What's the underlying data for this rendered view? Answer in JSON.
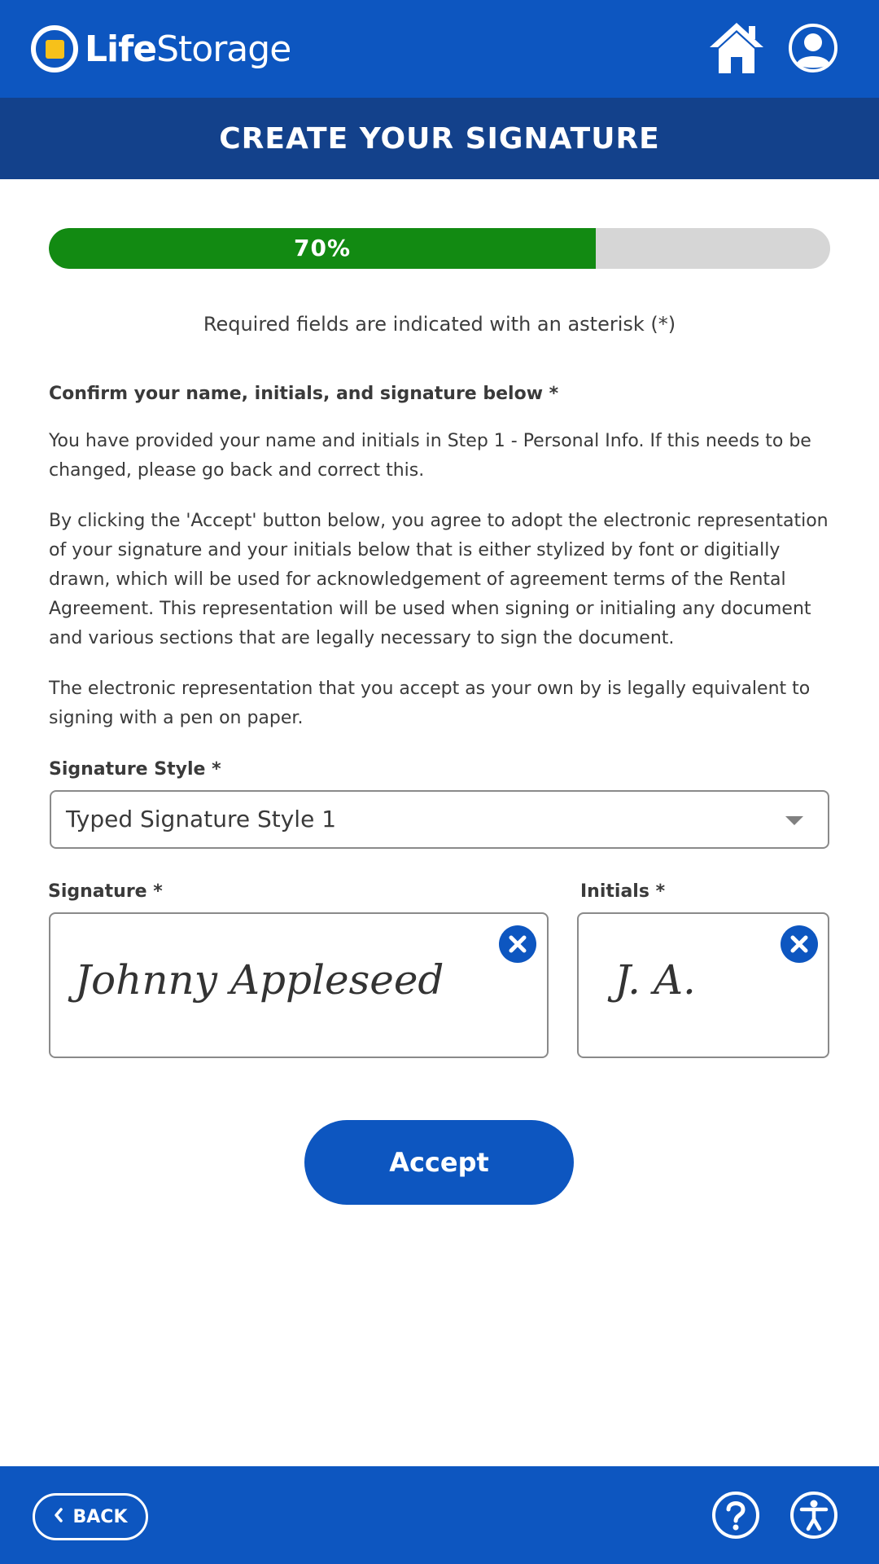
{
  "header": {
    "brand_bold": "Life",
    "brand_regular": "Storage",
    "icons": {
      "home": "home-icon",
      "profile": "user-profile-icon"
    }
  },
  "title": "CREATE YOUR SIGNATURE",
  "progress": {
    "percent": 70,
    "label": "70%"
  },
  "required_note": "Required fields are indicated with an asterisk (*)",
  "content": {
    "lead": "Confirm your name, initials, and signature below *",
    "paragraph1": "You have provided your name and initials in Step 1 - Personal Info. If this needs to be changed, please go back and correct this.",
    "paragraph2": "By clicking the 'Accept' button below, you agree to adopt the electronic representation of your signature and your initials below that is either stylized by font or digitially drawn, which will be used for acknowledgement of agreement terms of the Rental Agreement. This representation will be used when signing or initialing any document and various sections that are legally necessary to sign the document.",
    "paragraph3": "The electronic representation that you accept as your own by is legally equivalent to signing with a pen on paper."
  },
  "signature_style": {
    "label": "Signature Style *",
    "selected": "Typed Signature Style 1"
  },
  "signature": {
    "label": "Signature *",
    "value": "Johnny Appleseed"
  },
  "initials": {
    "label": "Initials *",
    "value": "J. A."
  },
  "accept_label": "Accept",
  "footer": {
    "back_label": "BACK",
    "icons": {
      "help": "help-icon",
      "accessibility": "accessibility-icon"
    }
  },
  "colors": {
    "primary": "#0d56c0",
    "title_bar": "#13418b",
    "progress_fill": "#128a12",
    "progress_track": "#d6d6d6",
    "logo_accent": "#f7c11a"
  }
}
